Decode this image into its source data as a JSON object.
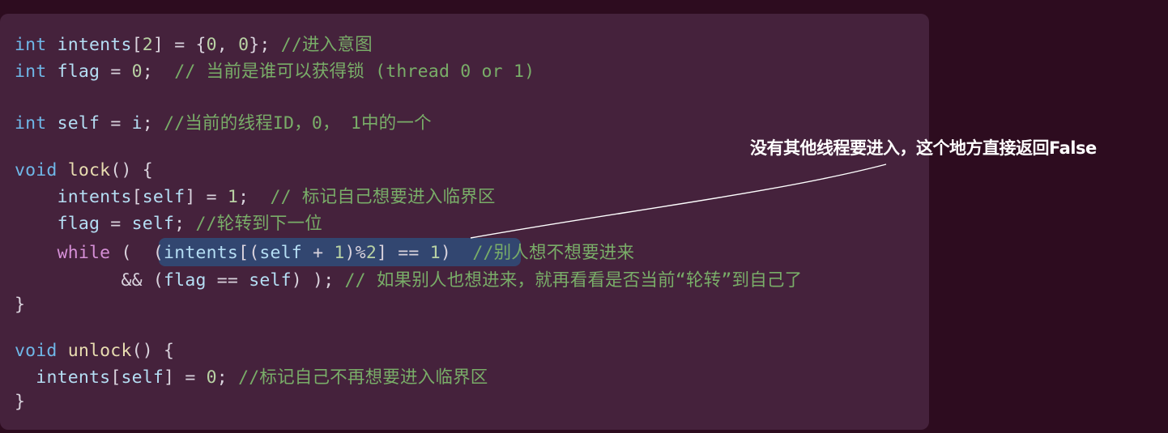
{
  "code": {
    "lines": [
      [
        {
          "t": "int",
          "c": "kw"
        },
        {
          "t": " intents",
          "c": "id"
        },
        {
          "t": "[",
          "c": "op"
        },
        {
          "t": "2",
          "c": "num"
        },
        {
          "t": "] = {",
          "c": "op"
        },
        {
          "t": "0",
          "c": "num"
        },
        {
          "t": ", ",
          "c": "op"
        },
        {
          "t": "0",
          "c": "num"
        },
        {
          "t": "}; ",
          "c": "op"
        },
        {
          "t": "//进入意图",
          "c": "cmt"
        }
      ],
      [
        {
          "t": "int",
          "c": "kw"
        },
        {
          "t": " flag",
          "c": "id"
        },
        {
          "t": " = ",
          "c": "op"
        },
        {
          "t": "0",
          "c": "num"
        },
        {
          "t": ";  ",
          "c": "op"
        },
        {
          "t": "// 当前是谁可以获得锁 (thread 0 or 1)",
          "c": "cmt"
        }
      ],
      [],
      [
        {
          "t": "int",
          "c": "kw"
        },
        {
          "t": " self",
          "c": "id"
        },
        {
          "t": " = ",
          "c": "op"
        },
        {
          "t": "i",
          "c": "id"
        },
        {
          "t": "; ",
          "c": "op"
        },
        {
          "t": "//当前的线程ID，0， 1中的一个",
          "c": "cmt"
        }
      ],
      [],
      [
        {
          "t": "void",
          "c": "kw"
        },
        {
          "t": " ",
          "c": "op"
        },
        {
          "t": "lock",
          "c": "fn"
        },
        {
          "t": "() {",
          "c": "op"
        }
      ],
      [
        {
          "t": "    ",
          "c": "op"
        },
        {
          "t": "intents",
          "c": "id"
        },
        {
          "t": "[",
          "c": "op"
        },
        {
          "t": "self",
          "c": "id"
        },
        {
          "t": "] = ",
          "c": "op"
        },
        {
          "t": "1",
          "c": "num"
        },
        {
          "t": ";  ",
          "c": "op"
        },
        {
          "t": "// 标记自己想要进入临界区",
          "c": "cmt"
        }
      ],
      [
        {
          "t": "    ",
          "c": "op"
        },
        {
          "t": "flag",
          "c": "id"
        },
        {
          "t": " = ",
          "c": "op"
        },
        {
          "t": "self",
          "c": "id"
        },
        {
          "t": "; ",
          "c": "op"
        },
        {
          "t": "//轮转到下一位",
          "c": "cmt"
        }
      ],
      [
        {
          "t": "    ",
          "c": "op"
        },
        {
          "t": "while",
          "c": "ctl"
        },
        {
          "t": " (  (",
          "c": "op"
        },
        {
          "t": "intents",
          "c": "id"
        },
        {
          "t": "[(",
          "c": "op"
        },
        {
          "t": "self",
          "c": "id"
        },
        {
          "t": " + ",
          "c": "op"
        },
        {
          "t": "1",
          "c": "num"
        },
        {
          "t": ")%",
          "c": "op"
        },
        {
          "t": "2",
          "c": "num"
        },
        {
          "t": "] == ",
          "c": "op"
        },
        {
          "t": "1",
          "c": "num"
        },
        {
          "t": ")  ",
          "c": "op"
        },
        {
          "t": "//别人想不想要进来",
          "c": "cmt"
        }
      ],
      [
        {
          "t": "          && (",
          "c": "op"
        },
        {
          "t": "flag",
          "c": "id"
        },
        {
          "t": " == ",
          "c": "op"
        },
        {
          "t": "self",
          "c": "id"
        },
        {
          "t": ") ); ",
          "c": "op"
        },
        {
          "t": "// 如果别人也想进来，就再看看是否当前“轮转”到自己了",
          "c": "cmt"
        }
      ],
      [
        {
          "t": "}",
          "c": "op"
        }
      ],
      [],
      [
        {
          "t": "void",
          "c": "kw"
        },
        {
          "t": " ",
          "c": "op"
        },
        {
          "t": "unlock",
          "c": "fn"
        },
        {
          "t": "() {",
          "c": "op"
        }
      ],
      [
        {
          "t": "  ",
          "c": "op"
        },
        {
          "t": "intents",
          "c": "id"
        },
        {
          "t": "[",
          "c": "op"
        },
        {
          "t": "self",
          "c": "id"
        },
        {
          "t": "] = ",
          "c": "op"
        },
        {
          "t": "0",
          "c": "num"
        },
        {
          "t": "; ",
          "c": "op"
        },
        {
          "t": "//标记自己不再想要进入临界区",
          "c": "cmt"
        }
      ],
      [
        {
          "t": "}",
          "c": "op"
        }
      ]
    ]
  },
  "annotation": {
    "text": "没有其他线程要进入，这个地方直接返回False"
  },
  "colors": {
    "background": "#2d0c1f",
    "panel": "#45223c",
    "highlight": "#314a75",
    "keyword": "#6fb7e8",
    "control": "#d58fd6",
    "identifier": "#b5def4",
    "function": "#e9ddb1",
    "number": "#b9d2a4",
    "comment": "#79ad68",
    "annotation": "#ffffff"
  }
}
